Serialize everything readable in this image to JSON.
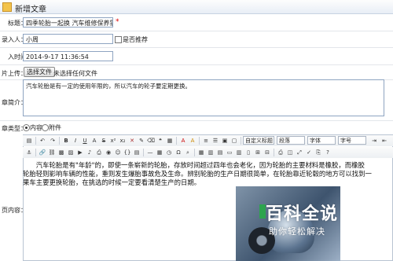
{
  "window": {
    "title": "新增文章"
  },
  "form": {
    "title_label": "标题：",
    "title_value": "四季轮胎一起换 汽车维修保养需知晓",
    "required_mark": "*",
    "author_label": "录入人：",
    "author_value": "小周",
    "recommend_label": "是否推荐",
    "time_label": "入时间",
    "time_value": "2014-9-17 11:36:54",
    "image_label": "片上传：",
    "choose_file_label": "选择文件",
    "no_file_label": "未选择任何文件",
    "summary_label": "章简介：",
    "summary_value": "汽车轮胎是有一定的使用年限的，所以汽车的轮子要定期更换。",
    "type_label": "章类型：",
    "type_options": [
      "内容",
      "附件"
    ],
    "content_label": "页内容："
  },
  "toolbar": {
    "font_family": "自定义标题",
    "paragraph": "段落",
    "font_face": "字体",
    "font_size": "字号"
  },
  "content": {
    "lines": [
      "汽车轮胎是有\"年龄\"的，即使一条崭新的轮胎，存放时间超过四年也会老化，因为轮胎的主要材料是橡胶，而橡胶",
      "轮胎轻则影响车辆的性能，重则发生爆胎事故危及生命。辨别轮胎的生产日期很简单，在轮胎靠近轮毂的地方可以找到一",
      "果车主要更换轮胎，在挑选的时候一定要看清楚生产的日期。"
    ]
  },
  "watermark": {
    "title": "百科全说",
    "subtitle": "助你轻松解决"
  }
}
